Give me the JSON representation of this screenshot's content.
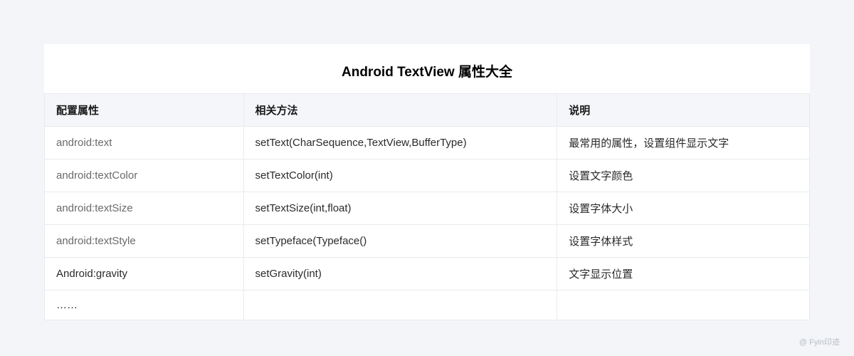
{
  "title": "Android TextView 属性大全",
  "headers": {
    "attr": "配置属性",
    "method": "相关方法",
    "desc": "说明"
  },
  "rows": [
    {
      "attr": "android:text",
      "method": "setText(CharSequence,TextView,BufferType)",
      "desc": "最常用的属性，设置组件显示文字"
    },
    {
      "attr": "android:textColor",
      "method": "setTextColor(int)",
      "desc": "设置文字颜色"
    },
    {
      "attr": "android:textSize",
      "method": "setTextSize(int,float)",
      "desc": "设置字体大小"
    },
    {
      "attr": "android:textStyle",
      "method": "setTypeface(Typeface()",
      "desc": "设置字体样式"
    },
    {
      "attr": "Android:gravity",
      "method": "setGravity(int)",
      "desc": "文字显示位置"
    },
    {
      "attr": "……",
      "method": "",
      "desc": ""
    }
  ],
  "watermark": "@ Fyin印迹"
}
